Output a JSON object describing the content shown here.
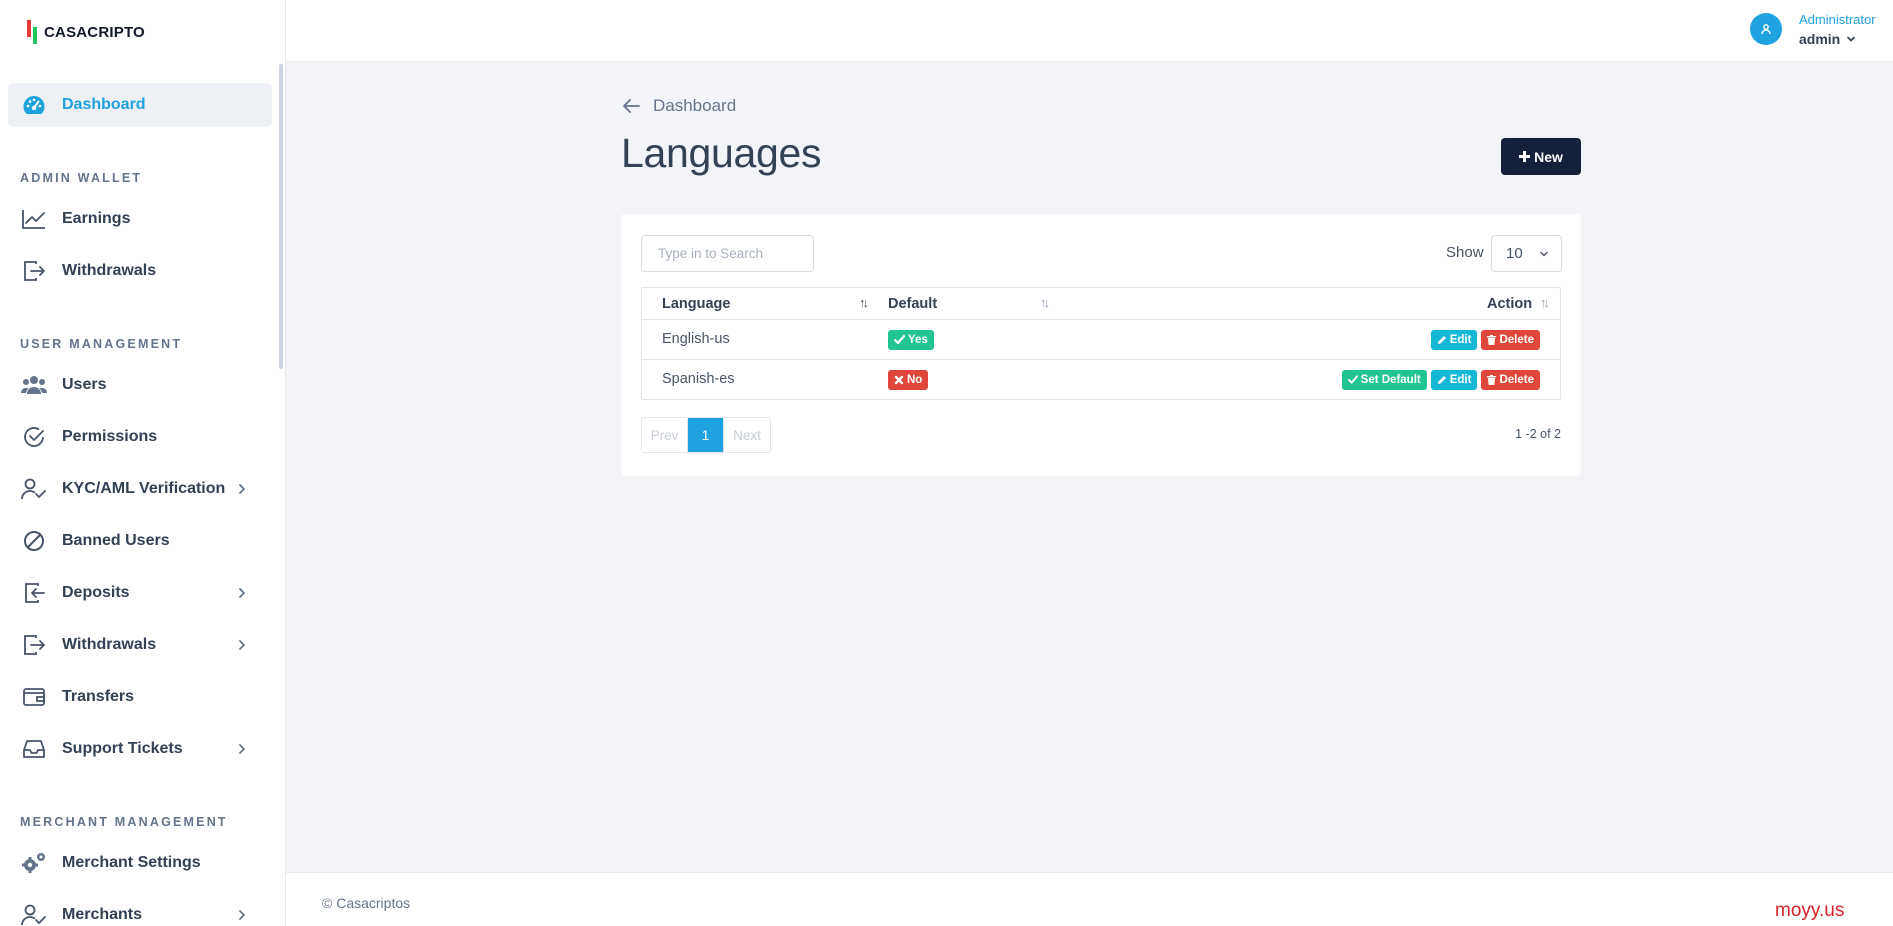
{
  "brand": {
    "name": "CASACRIPTO"
  },
  "sidebar": {
    "dashboard": "Dashboard",
    "sections": {
      "admin_wallet": "ADMIN WALLET",
      "user_management": "USER MANAGEMENT",
      "merchant_management": "MERCHANT MANAGEMENT"
    },
    "items": {
      "earnings": "Earnings",
      "withdrawals_wallet": "Withdrawals",
      "users": "Users",
      "permissions": "Permissions",
      "kyc": "KYC/AML Verification",
      "banned": "Banned Users",
      "deposits": "Deposits",
      "withdrawals": "Withdrawals",
      "transfers": "Transfers",
      "support": "Support Tickets",
      "merchant_settings": "Merchant Settings",
      "merchants": "Merchants"
    }
  },
  "header": {
    "role": "Administrator",
    "username": "admin"
  },
  "page": {
    "back_label": "Dashboard",
    "title": "Languages",
    "new_label": "New"
  },
  "toolbar": {
    "search_placeholder": "Type in to Search",
    "show_label": "Show",
    "show_value": "10"
  },
  "table": {
    "columns": {
      "language": "Language",
      "default": "Default",
      "action": "Action"
    },
    "rows": [
      {
        "language": "English-us",
        "default": "Yes",
        "edit": "Edit",
        "delete": "Delete"
      },
      {
        "language": "Spanish-es",
        "default": "No",
        "set_default": "Set Default",
        "edit": "Edit",
        "delete": "Delete"
      }
    ]
  },
  "pagination": {
    "prev": "Prev",
    "current": "1",
    "next": "Next",
    "summary": "1 -2 of 2"
  },
  "footer": {
    "copyright": "© Casacriptos"
  },
  "watermark": "moyy.us",
  "colors": {
    "accent": "#1fa2e0",
    "dark_button": "#15203a",
    "success": "#22c592",
    "danger": "#e0473a",
    "info": "#14b8d7"
  }
}
